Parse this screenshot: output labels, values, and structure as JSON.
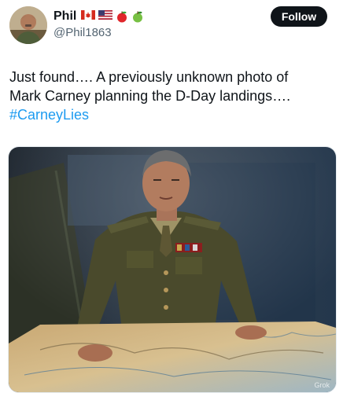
{
  "author": {
    "display_name": "Phil",
    "handle": "@Phil1863",
    "badges": [
      "flag-canada-icon",
      "flag-usa-icon",
      "red-apple-icon",
      "green-apple-icon"
    ]
  },
  "follow_label": "Follow",
  "tweet": {
    "line1": "Just found…. A previously unknown photo of",
    "line2": "Mark Carney planning the D-Day landings….",
    "hashtag": "#CarneyLies"
  },
  "media": {
    "watermark": "Grok"
  },
  "colors": {
    "text": "#0f1419",
    "secondary": "#536471",
    "link": "#1d9bf0",
    "button": "#0f1419"
  }
}
